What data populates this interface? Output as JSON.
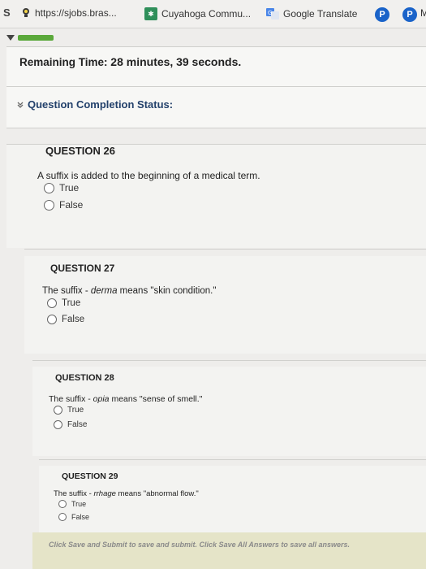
{
  "bookmarks": {
    "item_s": "S",
    "url_bookmark": "https://sjobs.bras...",
    "cuyahoga": "Cuyahoga Commu...",
    "google_translate": "Google Translate",
    "p1": "P",
    "p2": "P",
    "overflow": "M"
  },
  "progress": {
    "fraction": 1.0,
    "color": "#5aa83a"
  },
  "timer": {
    "label": "Remaining Time:",
    "minutes": "28 minutes,",
    "seconds": "39 seconds."
  },
  "completion_status": {
    "label": "Question Completion Status:"
  },
  "questions": [
    {
      "title": "QUESTION 26",
      "text_before": "A suffix is added to the beginning of a medical term.",
      "emph": "",
      "text_after": "",
      "options": [
        "True",
        "False"
      ]
    },
    {
      "title": "QUESTION 27",
      "text_before": "The suffix - ",
      "emph": "derma",
      "text_after": " means \"skin condition.\"",
      "options": [
        "True",
        "False"
      ]
    },
    {
      "title": "QUESTION 28",
      "text_before": "The suffix - ",
      "emph": "opia",
      "text_after": " means \"sense of smell.\"",
      "options": [
        "True",
        "False"
      ]
    },
    {
      "title": "QUESTION 29",
      "text_before": "The suffix - ",
      "emph": "rrhage",
      "text_after": " means \"abnormal flow.\"",
      "options": [
        "True",
        "False"
      ]
    }
  ],
  "footer": {
    "text": "Click Save and Submit to save and submit. Click Save All Answers to save all answers."
  },
  "colors": {
    "status_label": "#23416b",
    "progress": "#5aa83a"
  }
}
